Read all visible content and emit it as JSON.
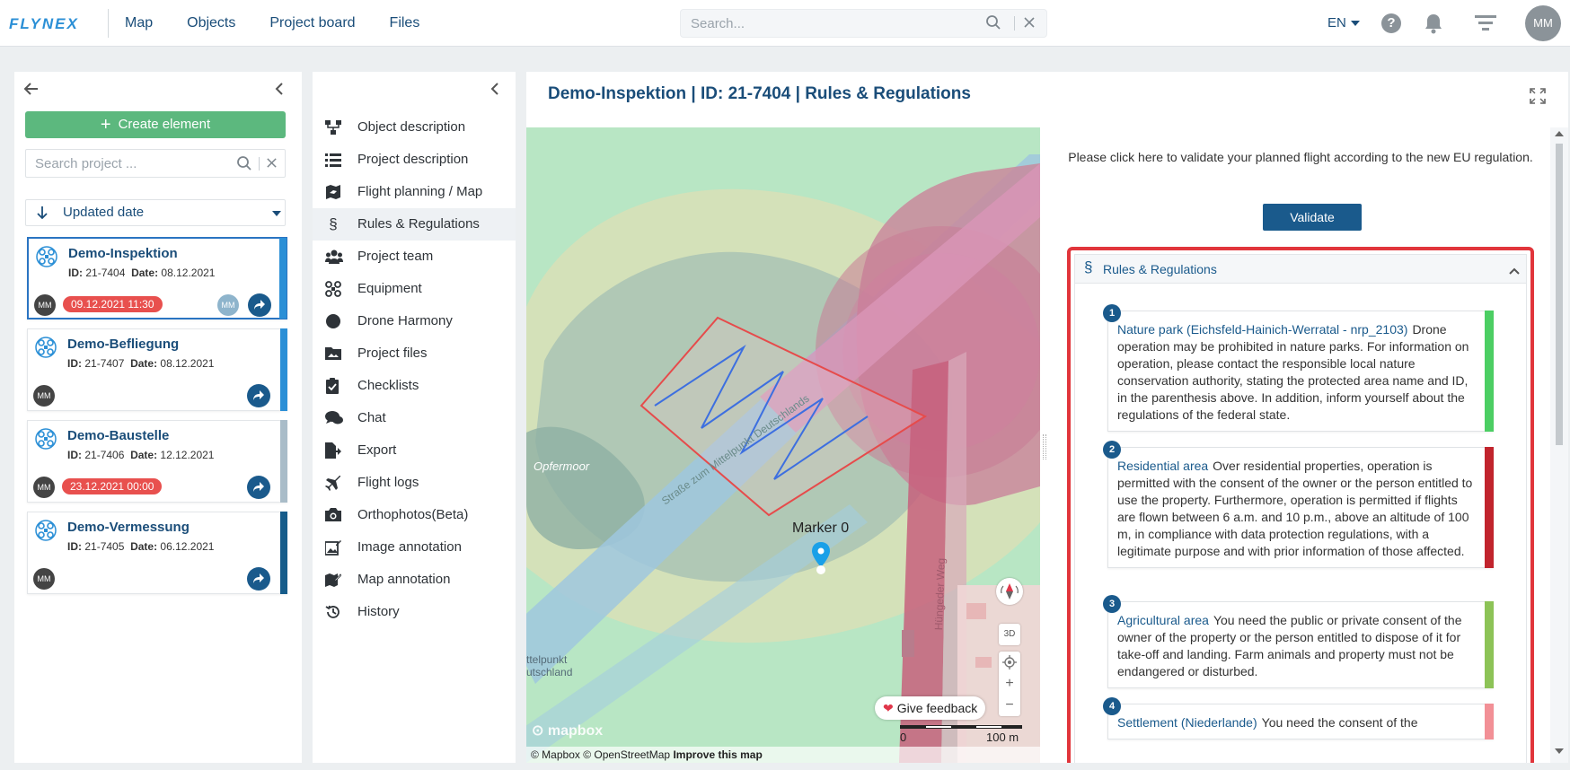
{
  "app": {
    "logo_text": "FLYNEX"
  },
  "topnav": {
    "items": [
      {
        "label": "Map"
      },
      {
        "label": "Objects"
      },
      {
        "label": "Project board"
      },
      {
        "label": "Files"
      }
    ],
    "search_placeholder": "Search...",
    "language": "EN",
    "help_glyph": "?",
    "user_initials": "MM"
  },
  "left": {
    "create_label": "Create element",
    "search_placeholder": "Search project ...",
    "sort_label": "Updated date",
    "projects": [
      {
        "name": "Demo-Inspektion",
        "id_label": "ID:",
        "id": "21-7404",
        "date_label": "Date:",
        "date": "08.12.2021",
        "owner": "MM",
        "due": "09.12.2021 11:30",
        "assignee": "MM",
        "stripe_color": "#2b8fd6"
      },
      {
        "name": "Demo-Befliegung",
        "id_label": "ID:",
        "id": "21-7407",
        "date_label": "Date:",
        "date": "08.12.2021",
        "owner": "MM",
        "due": "",
        "assignee": "",
        "stripe_color": "#2b8fd6"
      },
      {
        "name": "Demo-Baustelle",
        "id_label": "ID:",
        "id": "21-7406",
        "date_label": "Date:",
        "date": "12.12.2021",
        "owner": "MM",
        "due": "23.12.2021 00:00",
        "assignee": "",
        "stripe_color": "#a9bcc8"
      },
      {
        "name": "Demo-Vermessung",
        "id_label": "ID:",
        "id": "21-7405",
        "date_label": "Date:",
        "date": "06.12.2021",
        "owner": "MM",
        "due": "",
        "assignee": "",
        "stripe_color": "#165c8a"
      }
    ]
  },
  "menu": {
    "items": [
      {
        "label": "Object description",
        "icon": "sitemap-icon"
      },
      {
        "label": "Project description",
        "icon": "list-icon"
      },
      {
        "label": "Flight planning / Map",
        "icon": "map-plane-icon"
      },
      {
        "label": "Rules & Regulations",
        "icon": "paragraph-icon",
        "active": true
      },
      {
        "label": "Project team",
        "icon": "team-icon"
      },
      {
        "label": "Equipment",
        "icon": "drone-icon"
      },
      {
        "label": "Drone Harmony",
        "icon": "circle-icon"
      },
      {
        "label": "Project files",
        "icon": "image-folder-icon"
      },
      {
        "label": "Checklists",
        "icon": "clipboard-icon"
      },
      {
        "label": "Chat",
        "icon": "chat-icon"
      },
      {
        "label": "Export",
        "icon": "export-icon"
      },
      {
        "label": "Flight logs",
        "icon": "plane-icon"
      },
      {
        "label": "Orthophotos(Beta)",
        "icon": "camera-icon"
      },
      {
        "label": "Image annotation",
        "icon": "image-edit-icon"
      },
      {
        "label": "Map annotation",
        "icon": "map-edit-icon"
      },
      {
        "label": "History",
        "icon": "history-icon"
      }
    ]
  },
  "main": {
    "title": "Demo-Inspektion | ID: 21-7404 | Rules & Regulations"
  },
  "map": {
    "place_label_1": "Opfermoor",
    "place_label_2a": "ttelpunkt",
    "place_label_2b": "utschland",
    "road_label_1": "Straße zum Mittelpunkt Deutschlands",
    "road_label_2": "Hüngeder Weg",
    "marker_label": "Marker 0",
    "btn_3d": "3D",
    "zoom_in": "+",
    "zoom_out": "−",
    "feedback_label": "Give feedback",
    "scale_start": "0",
    "scale_end": "100 m",
    "logo": "mapbox",
    "attribution_1": "© Mapbox © OpenStreetMap",
    "attribution_2": "Improve this map"
  },
  "rules": {
    "validate_message": "Please click here to validate your planned flight according to the new EU regulation.",
    "validate_label": "Validate",
    "section_symbol": "§",
    "section_title": "Rules & Regulations",
    "items": [
      {
        "num": "1",
        "title": "Nature park (Eichsfeld-Hainich-Werratal - nrp_2103)",
        "text": "Drone operation may be prohibited in nature parks. For information on operation, please contact the responsible local nature conservation authority, stating the protected area name and ID, in the parenthesis above. In addition, inform yourself about the regulations of the federal state.",
        "color": "#4cce63"
      },
      {
        "num": "2",
        "title": "Residential area",
        "text": "Over residential properties, operation is permitted with the consent of the owner or the person entitled to use the property. Furthermore, operation is permitted if flights are flown between 6 a.m. and 10 p.m., above an altitude of 100 m, in compliance with data protection regulations, with a legitimate purpose and with prior information of those affected.",
        "color": "#c1242d"
      },
      {
        "num": "3",
        "title": "Agricultural area",
        "text": "You need the public or private consent of the owner of the property or the person entitled to dispose of it for take-off and landing. Farm animals and property must not be endangered or disturbed.",
        "color": "#8dc357"
      },
      {
        "num": "4",
        "title": "Settlement (Niederlande)",
        "text": "You need the consent of the",
        "color": "#f29096"
      }
    ]
  }
}
